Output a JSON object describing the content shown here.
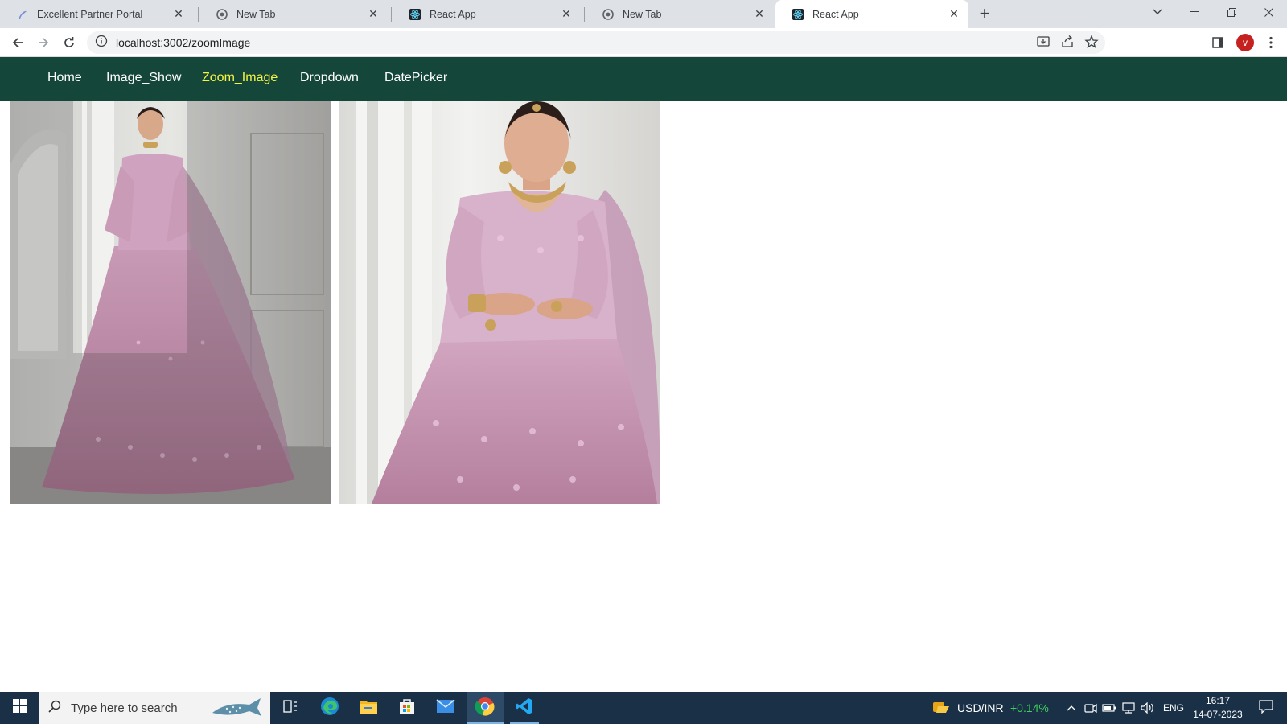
{
  "browser": {
    "tabs": [
      {
        "title": "Excellent Partner Portal",
        "icon": "portal-favicon-icon",
        "active": false
      },
      {
        "title": "New Tab",
        "icon": "chrome-favicon-icon",
        "active": false
      },
      {
        "title": "React App",
        "icon": "react-favicon-icon",
        "active": false
      },
      {
        "title": "New Tab",
        "icon": "chrome-favicon-icon",
        "active": false
      },
      {
        "title": "React App",
        "icon": "react-favicon-icon",
        "active": true
      }
    ],
    "address": {
      "url": "localhost:3002/zoomImage"
    },
    "profile_initial": "v"
  },
  "app_nav": {
    "links": [
      {
        "label": "Home",
        "active": false
      },
      {
        "label": "Image_Show",
        "active": false
      },
      {
        "label": "Zoom_Image",
        "active": true
      },
      {
        "label": "Dropdown",
        "active": false
      },
      {
        "label": "DatePicker",
        "active": false
      }
    ],
    "active_color": "#f5f542",
    "background_color": "#14463a"
  },
  "images": {
    "source": {
      "name": "lehenga-full-image"
    },
    "zoom": {
      "name": "lehenga-zoomed-image"
    }
  },
  "taskbar": {
    "search_placeholder": "Type here to search",
    "ticker_label": "USD/INR",
    "ticker_change": "+0.14%",
    "ticker_change_color": "#3fcf5a",
    "language": "ENG",
    "time": "16:17",
    "date": "14-07-2023"
  }
}
